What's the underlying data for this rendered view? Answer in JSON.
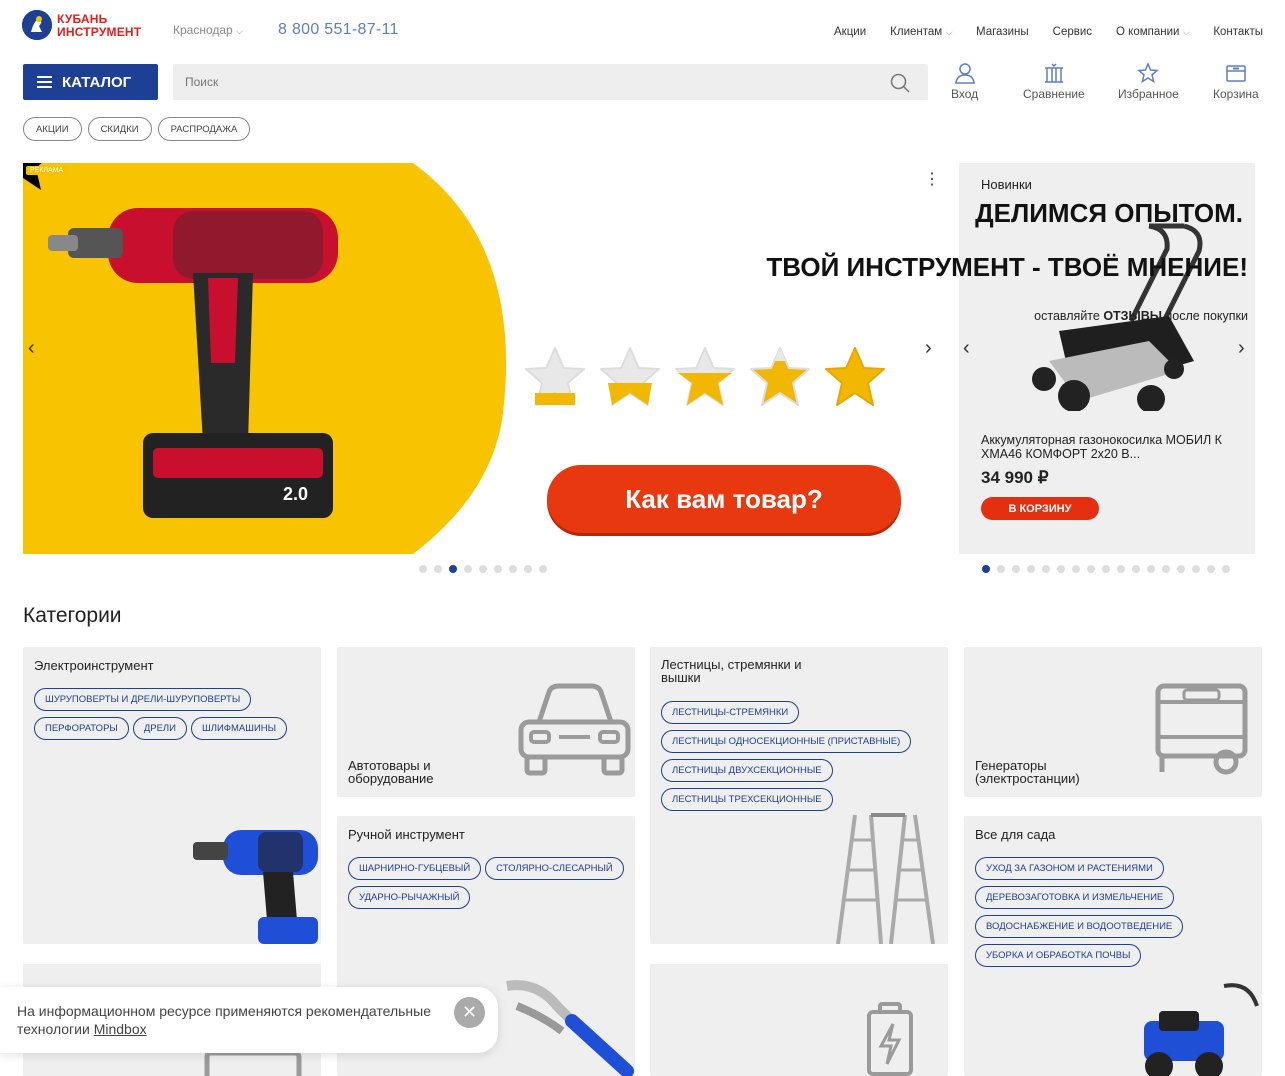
{
  "brand": {
    "line1": "КУБАНЬ",
    "line2": "ИНСТРУМЕНТ"
  },
  "city": "Краснодар",
  "phone": "8 800 551-87-11",
  "nav": [
    {
      "label": "Акции",
      "dropdown": false
    },
    {
      "label": "Клиентам",
      "dropdown": true
    },
    {
      "label": "Магазины",
      "dropdown": false
    },
    {
      "label": "Сервис",
      "dropdown": false
    },
    {
      "label": "О компании",
      "dropdown": true
    },
    {
      "label": "Контакты",
      "dropdown": false
    }
  ],
  "catalog_label": "КАТАЛОГ",
  "search": {
    "placeholder": "Поиск"
  },
  "header_actions": {
    "login": "Вход",
    "compare": "Сравнение",
    "favorites": "Избранное",
    "cart": "Корзина"
  },
  "pills": [
    "АКЦИИ",
    "СКИДКИ",
    "РАСПРОДАЖА"
  ],
  "banner": {
    "badge": "РЕКЛАМА",
    "title1": "ДЕЛИМСЯ ОПЫТОМ.",
    "title2": "ТВОЙ ИНСТРУМЕНТ - ТВОЁ МНЕНИЕ!",
    "sub_pre": "оставляйте ",
    "sub_bold": "ОТЗЫВЫ",
    "sub_post": " после покупки",
    "cta": "Как вам товар?",
    "stars_filled": [
      0.1,
      0.35,
      0.6,
      0.85,
      1.0
    ],
    "slides": 9,
    "active": 2,
    "colors": {
      "yellow": "#f8c300",
      "cta": "#e8380f"
    }
  },
  "novinki": {
    "title": "Новинки",
    "product_name": "Аккумуляторная газонокосилка МОБИЛ К ХМА46 КОМФОРТ 2x20 В...",
    "price": "34 990 ₽",
    "button": "В КОРЗИНУ",
    "slides": 17,
    "active": 0
  },
  "categories_title": "Категории",
  "categories": {
    "power_tools": {
      "title": "Электроинструмент",
      "tags": [
        "ШУРУПОВЕРТЫ И ДРЕЛИ-ШУРУПОВЕРТЫ",
        "ПЕРФОРАТОРЫ",
        "ДРЕЛИ",
        "ШЛИФМАШИНЫ"
      ]
    },
    "auto": {
      "title": "Автотовары и оборудование"
    },
    "ladders": {
      "title": "Лестницы, стремянки и вышки",
      "tags": [
        "ЛЕСТНИЦЫ-СТРЕМЯНКИ",
        "ЛЕСТНИЦЫ ОДНОСЕКЦИОННЫЕ (ПРИСТАВНЫЕ)",
        "ЛЕСТНИЦЫ ДВУХСЕКЦИОННЫЕ",
        "ЛЕСТНИЦЫ ТРЕХСЕКЦИОННЫЕ"
      ]
    },
    "generators": {
      "title": "Генераторы (электростанции)"
    },
    "hand_tools": {
      "title": "Ручной инструмент",
      "tags": [
        "ШАРНИРНО-ГУБЦЕВЫЙ",
        "СТОЛЯРНО-СЛЕСАРНЫЙ",
        "УДАРНО-РЫЧАЖНЫЙ"
      ]
    },
    "garden": {
      "title": "Все для сада",
      "tags": [
        "УХОД ЗА ГАЗОНОМ И РАСТЕНИЯМИ",
        "ДЕРЕВОЗАГОТОВКА И ИЗМЕЛЬЧЕНИЕ",
        "ВОДОСНАБЖЕНИЕ И ВОДООТВЕДЕНИЕ",
        "УБОРКА И ОБРАБОТКА ПОЧВЫ"
      ]
    }
  },
  "cookie": {
    "text": "На информационном ресурсе применяются рекомендательные технологии ",
    "link": "Mindbox"
  },
  "colors": {
    "brand_blue": "#1d3f94",
    "brand_red": "#e11d1d"
  }
}
